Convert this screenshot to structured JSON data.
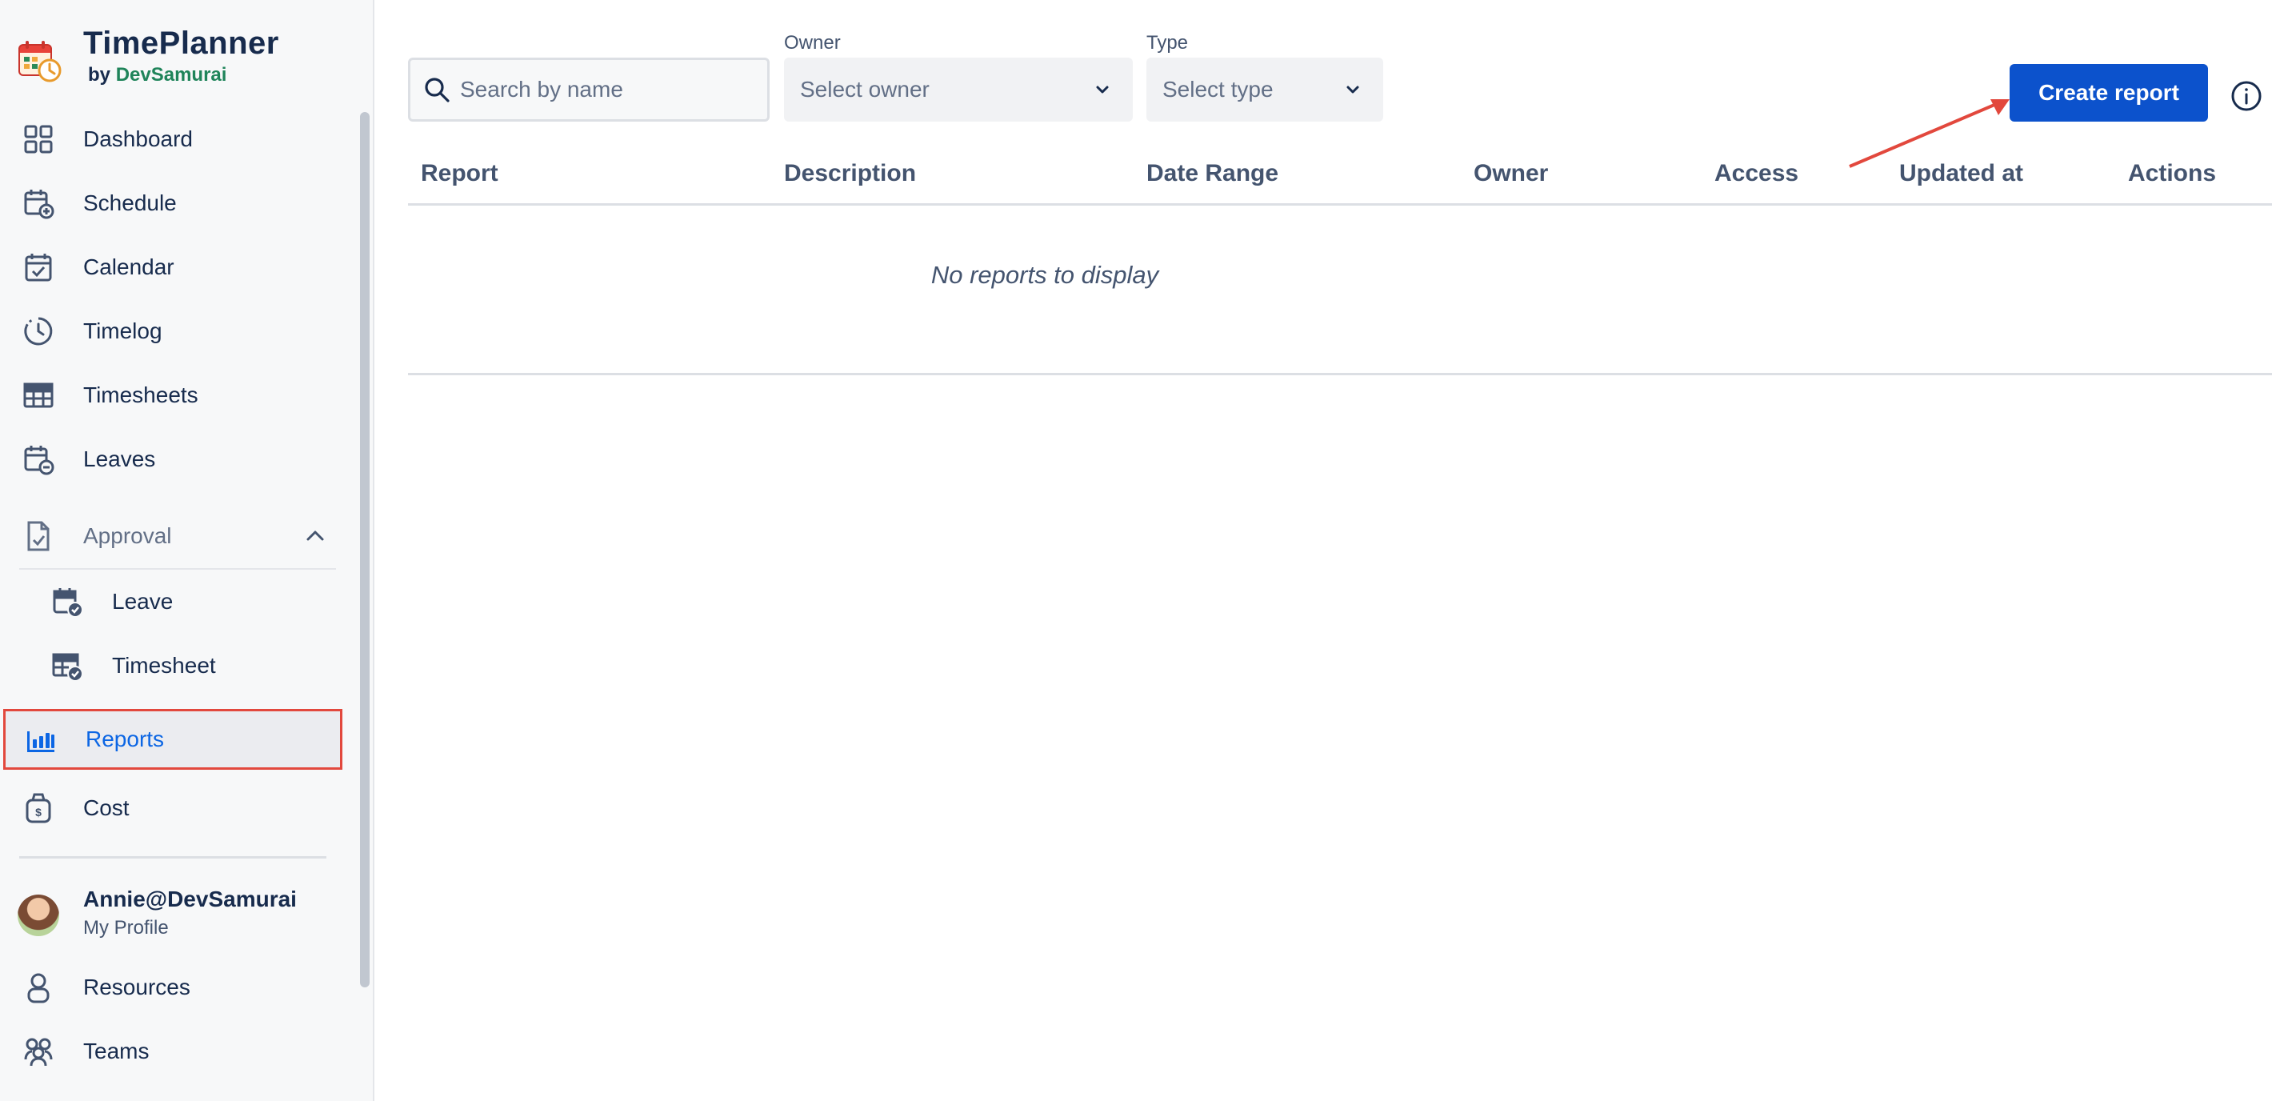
{
  "app": {
    "title": "TimePlanner",
    "by_prefix": "by",
    "by_company": "DevSamurai"
  },
  "colors": {
    "primary": "#0c52cc",
    "active_text": "#0c66e4",
    "highlight_border": "#e2483d",
    "brand_green": "#1f845a"
  },
  "sidebar": {
    "items": [
      {
        "label": "Dashboard",
        "icon": "dashboard-icon"
      },
      {
        "label": "Schedule",
        "icon": "calendar-plus-icon"
      },
      {
        "label": "Calendar",
        "icon": "calendar-check-icon"
      },
      {
        "label": "Timelog",
        "icon": "clock-icon"
      },
      {
        "label": "Timesheets",
        "icon": "table-icon"
      },
      {
        "label": "Leaves",
        "icon": "calendar-minus-icon"
      }
    ],
    "approval": {
      "label": "Approval",
      "icon": "document-check-icon",
      "expanded": true,
      "children": [
        {
          "label": "Leave",
          "icon": "calendar-approve-icon"
        },
        {
          "label": "Timesheet",
          "icon": "timesheet-approve-icon"
        }
      ]
    },
    "reports": {
      "label": "Reports",
      "icon": "bar-chart-icon",
      "active": true
    },
    "cost": {
      "label": "Cost",
      "icon": "money-bag-icon"
    },
    "profile": {
      "name": "Annie@DevSamurai",
      "subtitle": "My Profile"
    },
    "bottom_items": [
      {
        "label": "Resources",
        "icon": "person-icon"
      },
      {
        "label": "Teams",
        "icon": "people-group-icon"
      }
    ]
  },
  "filters": {
    "search_placeholder": "Search by name",
    "owner": {
      "label": "Owner",
      "placeholder": "Select owner"
    },
    "type": {
      "label": "Type",
      "placeholder": "Select type"
    }
  },
  "actions": {
    "create_label": "Create report"
  },
  "table": {
    "columns": [
      "Report",
      "Description",
      "Date Range",
      "Owner",
      "Access",
      "Updated at",
      "Actions"
    ],
    "empty_text": "No reports to display"
  }
}
